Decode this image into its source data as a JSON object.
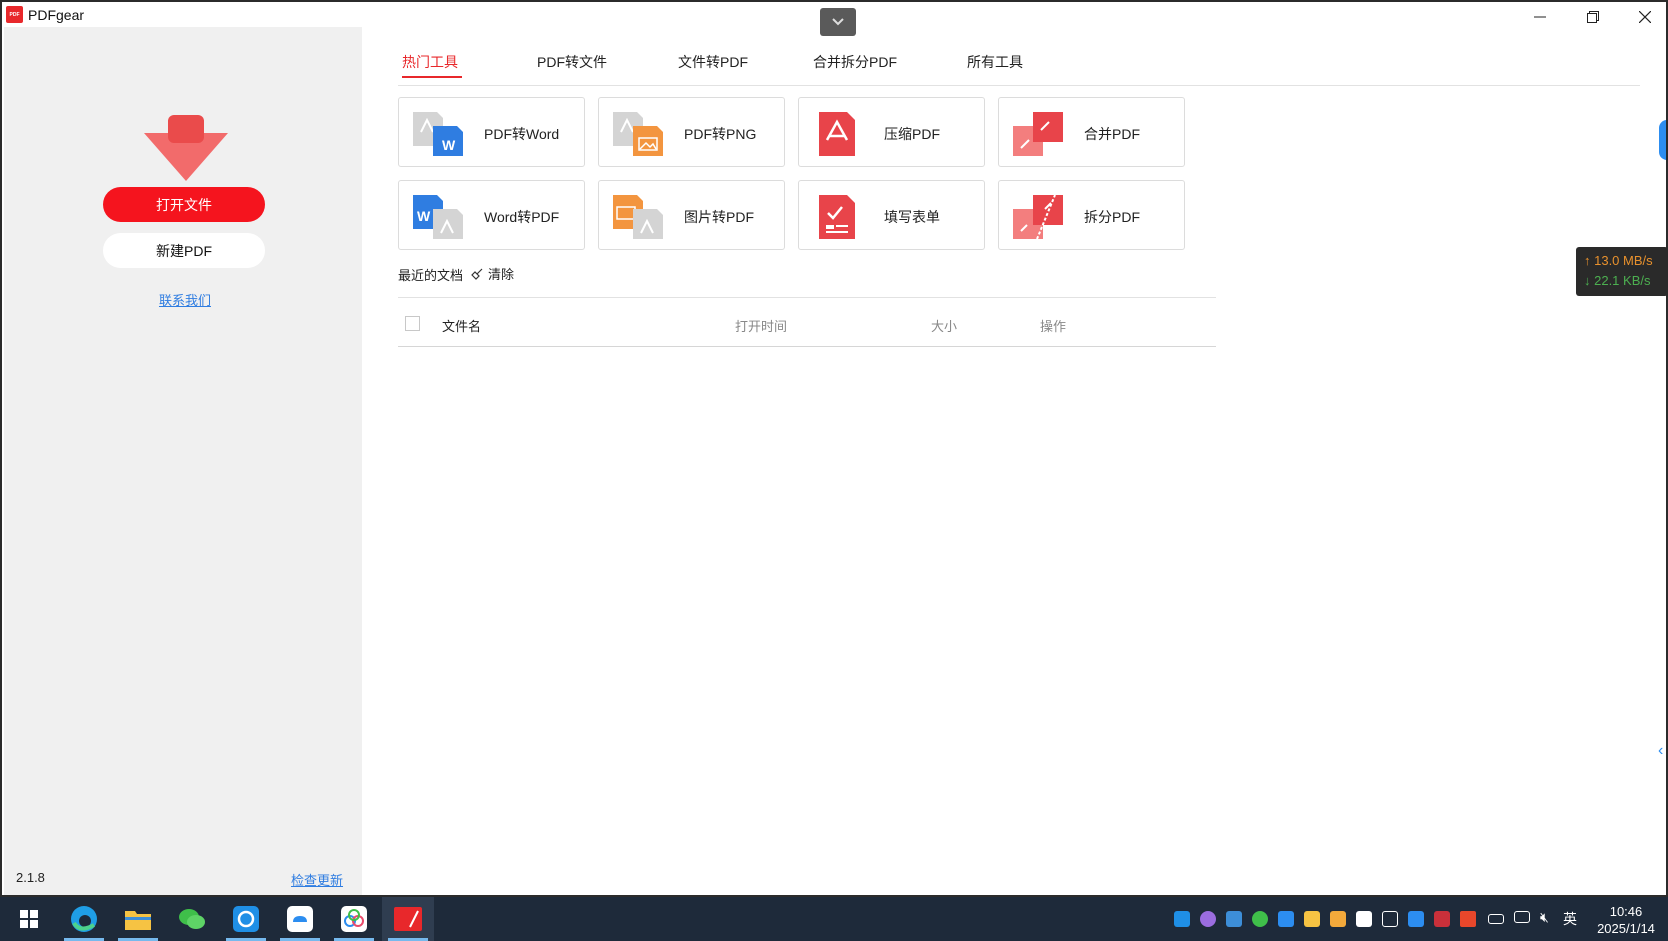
{
  "window": {
    "title": "PDFgear",
    "logo_text": "PDF"
  },
  "sidebar": {
    "open_file": "打开文件",
    "new_pdf": "新建PDF",
    "contact": "联系我们",
    "version": "2.1.8",
    "check_update": "检查更新"
  },
  "tabs": [
    {
      "label": "热门工具",
      "active": true
    },
    {
      "label": "PDF转文件"
    },
    {
      "label": "文件转PDF"
    },
    {
      "label": "合并拆分PDF"
    },
    {
      "label": "所有工具"
    }
  ],
  "tools": [
    {
      "label": "PDF转Word",
      "icon": "pdf-to-word-icon"
    },
    {
      "label": "PDF转PNG",
      "icon": "pdf-to-png-icon"
    },
    {
      "label": "压缩PDF",
      "icon": "compress-pdf-icon"
    },
    {
      "label": "合并PDF",
      "icon": "merge-pdf-icon"
    },
    {
      "label": "Word转PDF",
      "icon": "word-to-pdf-icon"
    },
    {
      "label": "图片转PDF",
      "icon": "image-to-pdf-icon"
    },
    {
      "label": "填写表单",
      "icon": "fill-form-icon"
    },
    {
      "label": "拆分PDF",
      "icon": "split-pdf-icon"
    }
  ],
  "recent": {
    "title": "最近的文档",
    "clear": "清除",
    "columns": {
      "name": "文件名",
      "open_time": "打开时间",
      "size": "大小",
      "actions": "操作"
    },
    "rows": []
  },
  "netspeed": {
    "up": "↑ 13.0 MB/s",
    "down": "↓ 22.1 KB/s"
  },
  "taskbar": {
    "apps": [
      "start-icon",
      "edge-icon",
      "file-explorer-icon",
      "wechat-icon",
      "sync-app-icon",
      "cloud-app-icon",
      "baidu-netdisk-icon",
      "pdfgear-icon"
    ],
    "ime": "英",
    "time": "10:46",
    "date": "2025/1/14"
  },
  "colors": {
    "accent": "#e8282b",
    "link": "#2f7de1",
    "sidebar_bg": "#f0f0f0"
  }
}
